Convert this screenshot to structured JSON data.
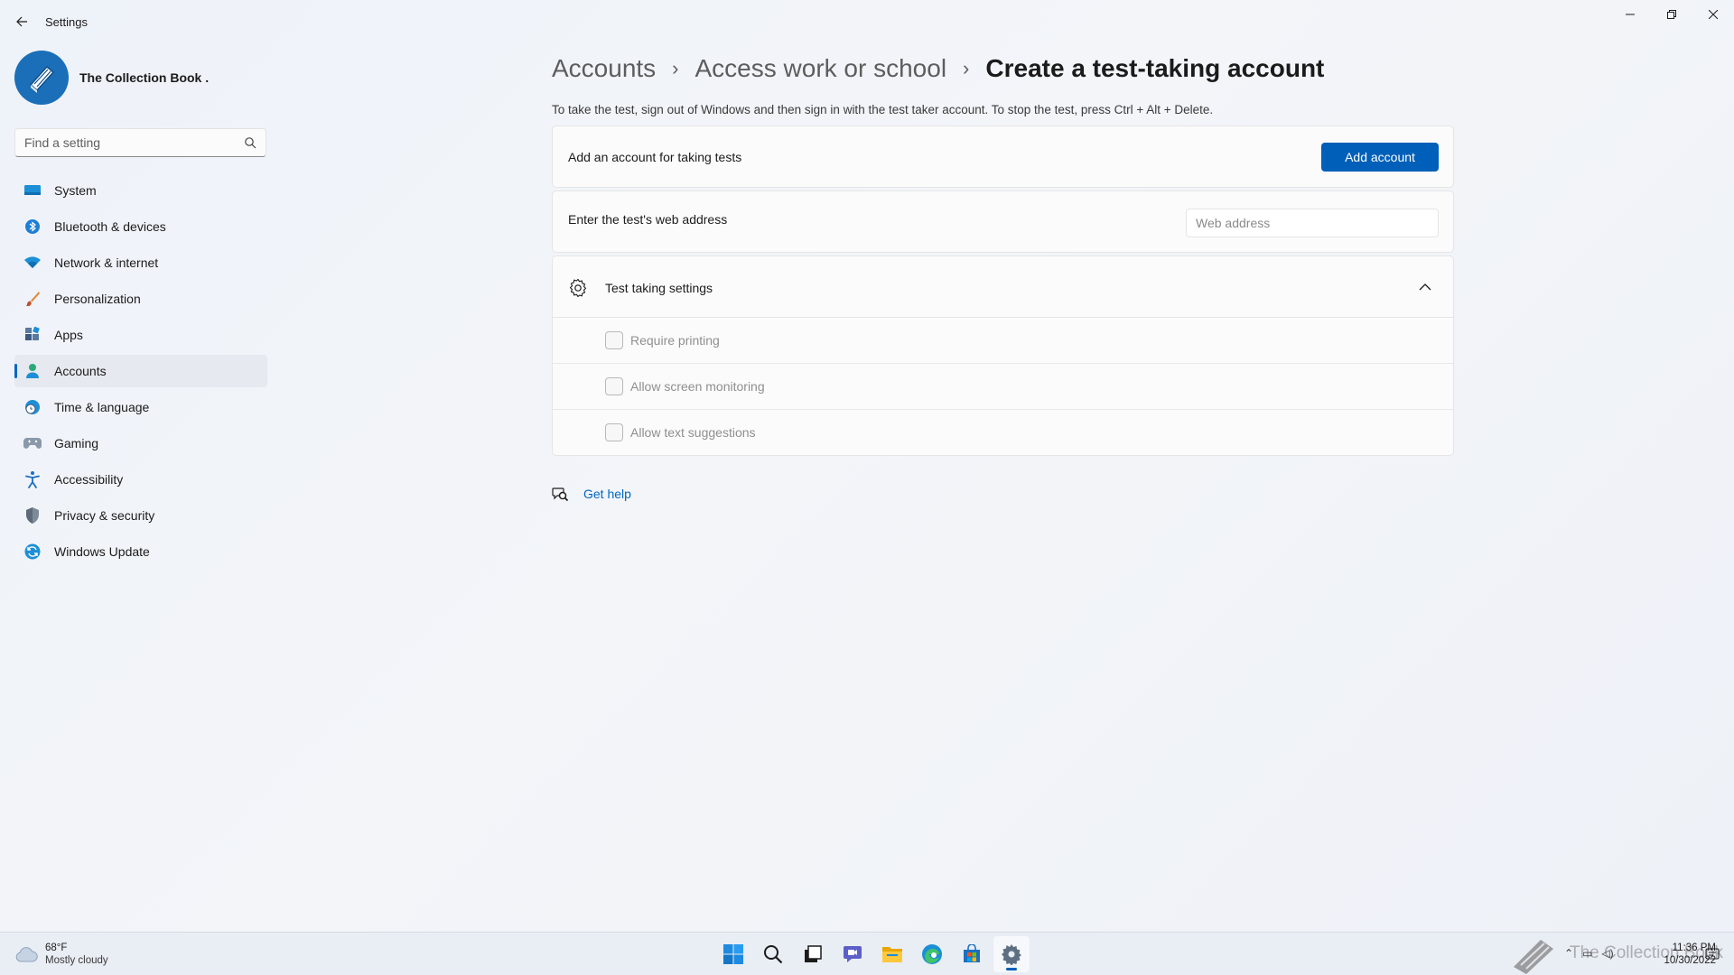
{
  "window": {
    "app_title": "Settings"
  },
  "profile": {
    "name": "The Collection Book ."
  },
  "search": {
    "placeholder": "Find a setting"
  },
  "sidebar": {
    "items": [
      {
        "label": "System",
        "icon": "monitor-icon"
      },
      {
        "label": "Bluetooth & devices",
        "icon": "bluetooth-icon"
      },
      {
        "label": "Network & internet",
        "icon": "wifi-icon"
      },
      {
        "label": "Personalization",
        "icon": "brush-icon"
      },
      {
        "label": "Apps",
        "icon": "apps-icon"
      },
      {
        "label": "Accounts",
        "icon": "person-icon",
        "active": true
      },
      {
        "label": "Time & language",
        "icon": "globe-clock-icon"
      },
      {
        "label": "Gaming",
        "icon": "gamepad-icon"
      },
      {
        "label": "Accessibility",
        "icon": "accessibility-icon"
      },
      {
        "label": "Privacy & security",
        "icon": "shield-icon"
      },
      {
        "label": "Windows Update",
        "icon": "update-icon"
      }
    ]
  },
  "breadcrumb": {
    "items": [
      "Accounts",
      "Access work or school"
    ],
    "current": "Create a test-taking account"
  },
  "main": {
    "description": "To take the test, sign out of Windows and then sign in with the test taker account. To stop the test, press Ctrl + Alt + Delete.",
    "add_card": {
      "label": "Add an account for taking tests",
      "button_label": "Add account"
    },
    "web_card": {
      "label": "Enter the test's web address",
      "input_placeholder": "Web address",
      "input_value": ""
    },
    "settings_card": {
      "title": "Test taking settings",
      "expanded": true,
      "options": [
        {
          "label": "Require printing",
          "checked": false
        },
        {
          "label": "Allow screen monitoring",
          "checked": false
        },
        {
          "label": "Allow text suggestions",
          "checked": false
        }
      ]
    },
    "help_label": "Get help"
  },
  "taskbar": {
    "weather_temp": "68°F",
    "weather_condition": "Mostly cloudy",
    "apps": [
      "start-icon",
      "search-icon",
      "task-view-icon",
      "chat-icon",
      "file-explorer-icon",
      "edge-icon",
      "store-icon",
      "settings-icon"
    ],
    "active_app": "settings-icon",
    "watermark": "The Collection Book",
    "time": "11:36 PM",
    "date": "10/30/2022"
  },
  "colors": {
    "accent": "#005fb8",
    "link": "#0067c0",
    "background": "#eef2f8"
  }
}
